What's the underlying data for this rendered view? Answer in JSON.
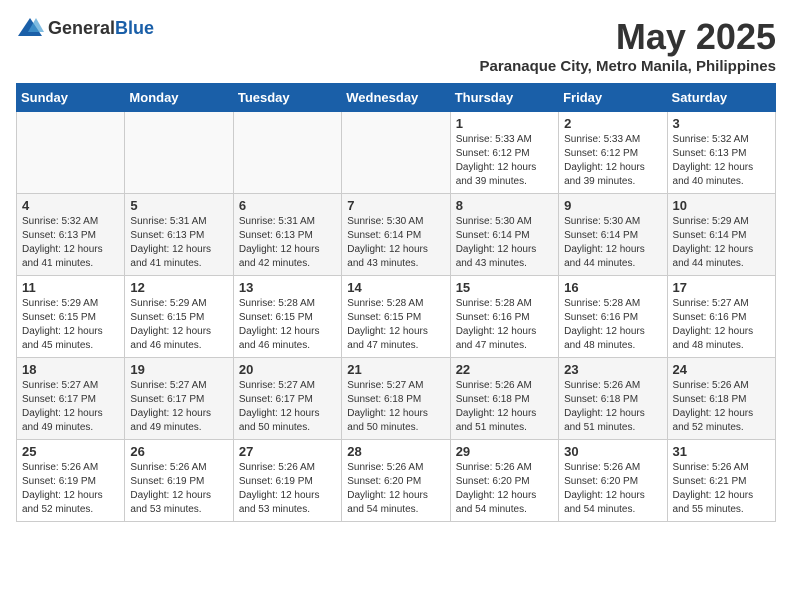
{
  "header": {
    "logo_general": "General",
    "logo_blue": "Blue",
    "month_year": "May 2025",
    "location": "Paranaque City, Metro Manila, Philippines"
  },
  "days_of_week": [
    "Sunday",
    "Monday",
    "Tuesday",
    "Wednesday",
    "Thursday",
    "Friday",
    "Saturday"
  ],
  "weeks": [
    [
      {
        "day": "",
        "info": ""
      },
      {
        "day": "",
        "info": ""
      },
      {
        "day": "",
        "info": ""
      },
      {
        "day": "",
        "info": ""
      },
      {
        "day": "1",
        "info": "Sunrise: 5:33 AM\nSunset: 6:12 PM\nDaylight: 12 hours\nand 39 minutes."
      },
      {
        "day": "2",
        "info": "Sunrise: 5:33 AM\nSunset: 6:12 PM\nDaylight: 12 hours\nand 39 minutes."
      },
      {
        "day": "3",
        "info": "Sunrise: 5:32 AM\nSunset: 6:13 PM\nDaylight: 12 hours\nand 40 minutes."
      }
    ],
    [
      {
        "day": "4",
        "info": "Sunrise: 5:32 AM\nSunset: 6:13 PM\nDaylight: 12 hours\nand 41 minutes."
      },
      {
        "day": "5",
        "info": "Sunrise: 5:31 AM\nSunset: 6:13 PM\nDaylight: 12 hours\nand 41 minutes."
      },
      {
        "day": "6",
        "info": "Sunrise: 5:31 AM\nSunset: 6:13 PM\nDaylight: 12 hours\nand 42 minutes."
      },
      {
        "day": "7",
        "info": "Sunrise: 5:30 AM\nSunset: 6:14 PM\nDaylight: 12 hours\nand 43 minutes."
      },
      {
        "day": "8",
        "info": "Sunrise: 5:30 AM\nSunset: 6:14 PM\nDaylight: 12 hours\nand 43 minutes."
      },
      {
        "day": "9",
        "info": "Sunrise: 5:30 AM\nSunset: 6:14 PM\nDaylight: 12 hours\nand 44 minutes."
      },
      {
        "day": "10",
        "info": "Sunrise: 5:29 AM\nSunset: 6:14 PM\nDaylight: 12 hours\nand 44 minutes."
      }
    ],
    [
      {
        "day": "11",
        "info": "Sunrise: 5:29 AM\nSunset: 6:15 PM\nDaylight: 12 hours\nand 45 minutes."
      },
      {
        "day": "12",
        "info": "Sunrise: 5:29 AM\nSunset: 6:15 PM\nDaylight: 12 hours\nand 46 minutes."
      },
      {
        "day": "13",
        "info": "Sunrise: 5:28 AM\nSunset: 6:15 PM\nDaylight: 12 hours\nand 46 minutes."
      },
      {
        "day": "14",
        "info": "Sunrise: 5:28 AM\nSunset: 6:15 PM\nDaylight: 12 hours\nand 47 minutes."
      },
      {
        "day": "15",
        "info": "Sunrise: 5:28 AM\nSunset: 6:16 PM\nDaylight: 12 hours\nand 47 minutes."
      },
      {
        "day": "16",
        "info": "Sunrise: 5:28 AM\nSunset: 6:16 PM\nDaylight: 12 hours\nand 48 minutes."
      },
      {
        "day": "17",
        "info": "Sunrise: 5:27 AM\nSunset: 6:16 PM\nDaylight: 12 hours\nand 48 minutes."
      }
    ],
    [
      {
        "day": "18",
        "info": "Sunrise: 5:27 AM\nSunset: 6:17 PM\nDaylight: 12 hours\nand 49 minutes."
      },
      {
        "day": "19",
        "info": "Sunrise: 5:27 AM\nSunset: 6:17 PM\nDaylight: 12 hours\nand 49 minutes."
      },
      {
        "day": "20",
        "info": "Sunrise: 5:27 AM\nSunset: 6:17 PM\nDaylight: 12 hours\nand 50 minutes."
      },
      {
        "day": "21",
        "info": "Sunrise: 5:27 AM\nSunset: 6:18 PM\nDaylight: 12 hours\nand 50 minutes."
      },
      {
        "day": "22",
        "info": "Sunrise: 5:26 AM\nSunset: 6:18 PM\nDaylight: 12 hours\nand 51 minutes."
      },
      {
        "day": "23",
        "info": "Sunrise: 5:26 AM\nSunset: 6:18 PM\nDaylight: 12 hours\nand 51 minutes."
      },
      {
        "day": "24",
        "info": "Sunrise: 5:26 AM\nSunset: 6:18 PM\nDaylight: 12 hours\nand 52 minutes."
      }
    ],
    [
      {
        "day": "25",
        "info": "Sunrise: 5:26 AM\nSunset: 6:19 PM\nDaylight: 12 hours\nand 52 minutes."
      },
      {
        "day": "26",
        "info": "Sunrise: 5:26 AM\nSunset: 6:19 PM\nDaylight: 12 hours\nand 53 minutes."
      },
      {
        "day": "27",
        "info": "Sunrise: 5:26 AM\nSunset: 6:19 PM\nDaylight: 12 hours\nand 53 minutes."
      },
      {
        "day": "28",
        "info": "Sunrise: 5:26 AM\nSunset: 6:20 PM\nDaylight: 12 hours\nand 54 minutes."
      },
      {
        "day": "29",
        "info": "Sunrise: 5:26 AM\nSunset: 6:20 PM\nDaylight: 12 hours\nand 54 minutes."
      },
      {
        "day": "30",
        "info": "Sunrise: 5:26 AM\nSunset: 6:20 PM\nDaylight: 12 hours\nand 54 minutes."
      },
      {
        "day": "31",
        "info": "Sunrise: 5:26 AM\nSunset: 6:21 PM\nDaylight: 12 hours\nand 55 minutes."
      }
    ]
  ]
}
